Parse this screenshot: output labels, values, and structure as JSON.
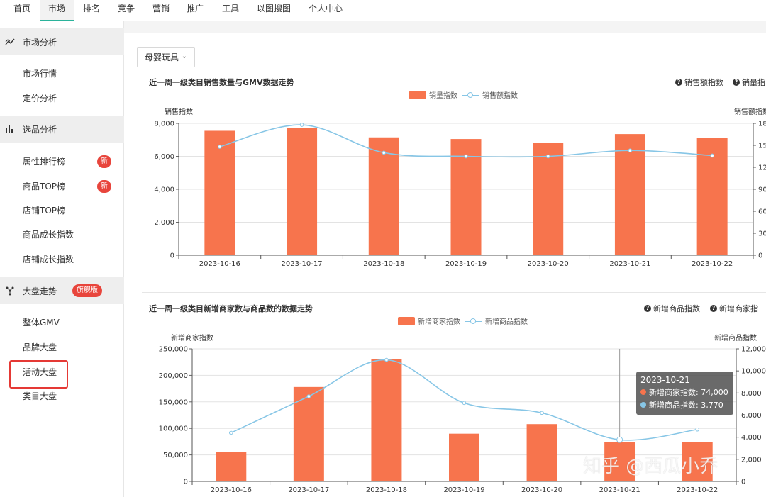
{
  "topnav": {
    "tabs": [
      {
        "label": "首页",
        "active": false
      },
      {
        "label": "市场",
        "active": true
      },
      {
        "label": "排名",
        "active": false
      },
      {
        "label": "竞争",
        "active": false
      },
      {
        "label": "营销",
        "active": false
      },
      {
        "label": "推广",
        "active": false
      },
      {
        "label": "工具",
        "active": false
      },
      {
        "label": "以图搜图",
        "active": false
      },
      {
        "label": "个人中心",
        "active": false
      }
    ]
  },
  "sidebar": {
    "sections": [
      {
        "title": "市场分析",
        "icon": "trend-line-icon",
        "items": [
          {
            "label": "市场行情"
          },
          {
            "label": "定价分析"
          }
        ]
      },
      {
        "title": "选品分析",
        "icon": "bar-chart-icon",
        "items": [
          {
            "label": "属性排行榜",
            "badge": "新"
          },
          {
            "label": "商品TOP榜",
            "badge": "新"
          },
          {
            "label": "店铺TOP榜"
          },
          {
            "label": "商品成长指数"
          },
          {
            "label": "店铺成长指数"
          }
        ]
      },
      {
        "title": "大盘走势",
        "icon": "snowflake-icon",
        "badge": "旗舰版",
        "items": [
          {
            "label": "整体GMV"
          },
          {
            "label": "品牌大盘"
          },
          {
            "label": "活动大盘"
          },
          {
            "label": "类目大盘",
            "selected": true
          }
        ]
      }
    ]
  },
  "filter": {
    "category": "母婴玩具"
  },
  "chart1_header": {
    "title": "近一周一级类目销售数量与GMV数据走势",
    "help": [
      "销售额指数",
      "销量指"
    ]
  },
  "chart2_header": {
    "title": "近一周一级类目新增商家数与商品数的数据走势",
    "help": [
      "新增商品指数",
      "新增商家指"
    ]
  },
  "tooltip": {
    "date": "2023-10-21",
    "rows": [
      {
        "label": "新增商家指数: 74,000",
        "color": "#f7744d"
      },
      {
        "label": "新增商品指数: 3,770",
        "color": "#87c6e6"
      }
    ]
  },
  "watermark": "知乎 @西瓜小乔",
  "chart_data": [
    {
      "type": "bar",
      "categories": [
        "2023-10-16",
        "2023-10-17",
        "2023-10-18",
        "2023-10-19",
        "2023-10-20",
        "2023-10-21",
        "2023-10-22"
      ],
      "series": [
        {
          "name": "销量指数",
          "type": "bar",
          "axis": "left",
          "values": [
            7550,
            7700,
            7150,
            7050,
            6800,
            7350,
            7100
          ]
        },
        {
          "name": "销售额指数",
          "type": "line",
          "axis": "right",
          "values": [
            14800,
            17800,
            14000,
            13500,
            13500,
            14300,
            13600
          ]
        }
      ],
      "ylabel_left": "销售指数",
      "ylabel_right": "销售额指数",
      "ylim_left": [
        0,
        8000
      ],
      "yticks_left": [
        "0",
        "2,000",
        "4,000",
        "6,000",
        "8,000"
      ],
      "ylim_right": [
        0,
        18000
      ],
      "yticks_right": [
        "0",
        "30",
        "60",
        "90",
        "12",
        "15",
        "18"
      ],
      "grid": true,
      "legend": "top-center",
      "colors": {
        "bar": "#f7744d",
        "line": "#87c6e6"
      }
    },
    {
      "type": "bar",
      "categories": [
        "2023-10-16",
        "2023-10-17",
        "2023-10-18",
        "2023-10-19",
        "2023-10-20",
        "2023-10-21",
        "2023-10-22"
      ],
      "series": [
        {
          "name": "新增商家指数",
          "type": "bar",
          "axis": "left",
          "values": [
            55000,
            178000,
            230000,
            90000,
            108000,
            74000,
            74000
          ]
        },
        {
          "name": "新增商品指数",
          "type": "line",
          "axis": "right",
          "values": [
            4400,
            7700,
            11000,
            7100,
            6200,
            3770,
            4700
          ]
        }
      ],
      "ylabel_left": "新增商家指数",
      "ylabel_right": "新增商品指数",
      "ylim_left": [
        0,
        250000
      ],
      "yticks_left": [
        "0",
        "50,000",
        "100,000",
        "150,000",
        "200,000",
        "250,000"
      ],
      "ylim_right": [
        0,
        12000
      ],
      "yticks_right": [
        "0",
        "2,000",
        "4,000",
        "6,000",
        "8,000",
        "10,000",
        "12,000"
      ],
      "grid": true,
      "legend": "top-center",
      "highlight": "2023-10-21",
      "colors": {
        "bar": "#f7744d",
        "line": "#87c6e6"
      }
    }
  ]
}
